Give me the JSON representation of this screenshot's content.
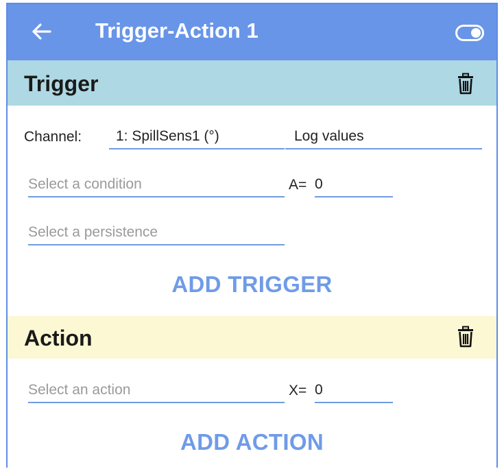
{
  "appbar": {
    "title": "Trigger-Action 1",
    "back_icon": "arrow-left-icon",
    "toggle_icon": "toggle-on-icon",
    "color": "#6895e8"
  },
  "trigger": {
    "title": "Trigger",
    "delete_icon": "trash-icon",
    "channel_label": "Channel:",
    "channel_value": "1: SpillSens1 (°)",
    "log_value": "Log values",
    "condition_placeholder": "Select a condition",
    "a_label": "A=",
    "a_value": "0",
    "persistence_placeholder": "Select a persistence",
    "add_button": "ADD TRIGGER",
    "header_color": "#aed8e3"
  },
  "action": {
    "title": "Action",
    "delete_icon": "trash-icon",
    "action_placeholder": "Select an action",
    "x_label": "X=",
    "x_value": "0",
    "add_button": "ADD ACTION",
    "header_color": "#fbf8d3"
  }
}
